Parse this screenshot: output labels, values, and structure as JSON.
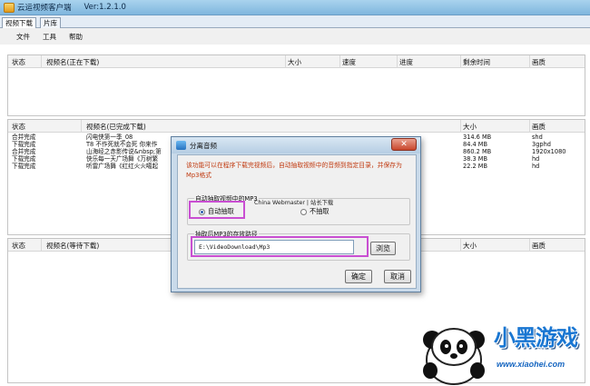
{
  "window": {
    "title": "云运视频客户端",
    "version": "Ver:1.2.1.0"
  },
  "tabs": [
    {
      "label": "视频下载"
    },
    {
      "label": "片库"
    }
  ],
  "menu": [
    {
      "label": "文件"
    },
    {
      "label": "工具"
    },
    {
      "label": "帮助"
    }
  ],
  "downloading": {
    "headers": {
      "status": "状态",
      "name": "视频名(正在下载)",
      "size": "大小",
      "speed": "速度",
      "progress": "进度",
      "remaining": "剩余时间",
      "quality": "画质"
    }
  },
  "completed": {
    "headers": {
      "status": "状态",
      "name": "视频名(已完成下载)",
      "size": "大小",
      "quality": "画质"
    },
    "rows": [
      {
        "status": "合并完成",
        "name": "闪电侠第一季_08",
        "size": "314.6 MB",
        "quality": "shd"
      },
      {
        "status": "下载完成",
        "name": "T8 不作死就不会死 你来作",
        "size": "84.4 MB",
        "quality": "3gphd"
      },
      {
        "status": "合并完成",
        "name": "山海经之赤影传说&nbsp;第",
        "size": "860.2 MB",
        "quality": "1920x1080"
      },
      {
        "status": "下载完成",
        "name": "快乐每一天广场舞《万树繁",
        "size": "38.3 MB",
        "quality": "hd"
      },
      {
        "status": "下载完成",
        "name": "听雷广场舞《红红火火噶起",
        "size": "22.2 MB",
        "quality": "hd"
      }
    ]
  },
  "waiting": {
    "headers": {
      "status": "状态",
      "name": "视频名(等待下载)",
      "size": "大小",
      "quality": "画质"
    }
  },
  "dialog": {
    "title": "分离音频",
    "close_symbol": "✕",
    "description": "该功能可以在程序下载完视频后，自动抽取视频中的音频到指定目录，并保存为Mp3格式",
    "auto_group_title": "自动抽取视频中的MP3",
    "watermark": "China Webmaster | 站长下载",
    "option_auto": "自动抽取",
    "option_none": "不抽取",
    "path_group_title": "抽取后MP3的存放路径",
    "path_value": "E:\\VideoDownload\\Mp3",
    "browse_label": "浏览",
    "ok_label": "确定",
    "cancel_label": "取消"
  },
  "logo": {
    "text": "小黑游戏",
    "url": "www.xiaohei.com"
  },
  "colors": {
    "highlight": "#c94fd2",
    "description": "#c03a10",
    "logo_blue": "#1976d2"
  }
}
